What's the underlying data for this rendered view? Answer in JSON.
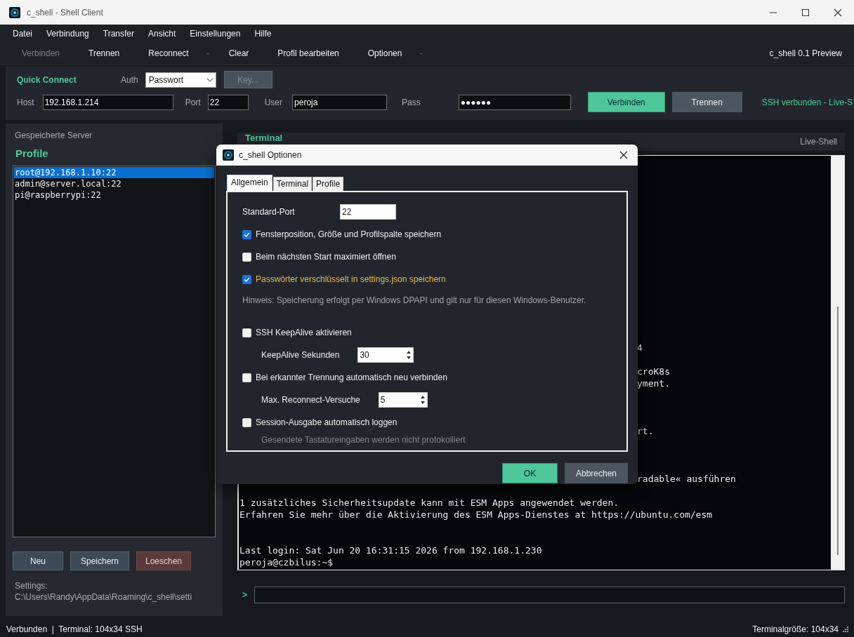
{
  "window": {
    "title": "c_shell - Shell Client"
  },
  "menu": [
    "Datei",
    "Verbindung",
    "Transfer",
    "Ansicht",
    "Einstellungen",
    "Hilfe"
  ],
  "toolbar": {
    "items": [
      {
        "kind": "button",
        "label": "Verbinden",
        "disabled": true
      },
      {
        "kind": "button",
        "label": "Trennen",
        "disabled": false
      },
      {
        "kind": "button",
        "label": "Reconnect",
        "disabled": false
      },
      {
        "kind": "separator",
        "label": "-"
      },
      {
        "kind": "button",
        "label": "Clear",
        "disabled": false
      },
      {
        "kind": "button",
        "label": "Profil bearbeiten",
        "disabled": false
      },
      {
        "kind": "button",
        "label": "Optionen",
        "disabled": false
      },
      {
        "kind": "separator",
        "label": "-"
      }
    ],
    "version": "c_shell 0.1 Preview"
  },
  "quick_connect": {
    "title": "Quick Connect",
    "auth_label": "Auth",
    "auth_value": "Passwort",
    "key_button": {
      "label": "Key...",
      "disabled": true
    },
    "host_label": "Host",
    "host": "192.168.1.214",
    "port_label": "Port",
    "port": "22",
    "user_label": "User",
    "user": "peroja",
    "pass_label": "Pass",
    "pass": "●●●●●●",
    "connect_button": "Verbinden",
    "disconnect_button": "Trennen",
    "status": "SSH verbunden - Live-S"
  },
  "profiles": {
    "caption": "Gespeicherte Server",
    "title": "Profile",
    "items": [
      {
        "label": "root@192.168.1.10:22",
        "selected": true
      },
      {
        "label": "admin@server.local:22",
        "selected": false
      },
      {
        "label": "pi@raspberrypi:22",
        "selected": false
      }
    ],
    "buttons": [
      {
        "label": "Neu",
        "kind": "normal"
      },
      {
        "label": "Speichern",
        "kind": "normal"
      },
      {
        "label": "Loeschen",
        "kind": "danger"
      }
    ],
    "settings_label": "Settings:",
    "settings_path": "C:\\Users\\Randy\\AppData\\Roaming\\c_shell\\setti"
  },
  "terminal": {
    "title": "Terminal",
    "mode": "Live-Shell",
    "prompt": ">",
    "lines": [
      {
        "kind": "tail",
        "text": "4"
      },
      {
        "kind": "blank"
      },
      {
        "kind": "tail",
        "text": "croK8s"
      },
      {
        "kind": "tail",
        "text": "yment."
      },
      {
        "kind": "blank"
      },
      {
        "kind": "blank"
      },
      {
        "kind": "blank"
      },
      {
        "kind": "tail",
        "text": "rt."
      },
      {
        "kind": "blank"
      },
      {
        "kind": "blank"
      },
      {
        "kind": "blank"
      },
      {
        "kind": "tail",
        "text": "radable« ausführen"
      },
      {
        "kind": "blank"
      },
      {
        "kind": "full",
        "text": "1 zusätzliches Sicherheitsupdate kann mit ESM Apps angewendet werden."
      },
      {
        "kind": "full",
        "text": "Erfahren Sie mehr über die Aktivierung des ESM Apps-Dienstes at https://ubuntu.com/esm"
      },
      {
        "kind": "blank"
      },
      {
        "kind": "blank"
      },
      {
        "kind": "full",
        "text": "Last login: Sat Jun 20 16:31:15 2026 from 192.168.1.230"
      },
      {
        "kind": "full",
        "text": "peroja@czbilus:~$"
      }
    ]
  },
  "dialog": {
    "title": "c_shell Optionen",
    "tabs": [
      {
        "label": "Allgemein",
        "selected": true
      },
      {
        "label": "Terminal",
        "selected": false
      },
      {
        "label": "Profile",
        "selected": false
      }
    ],
    "rows": [
      {
        "kind": "field",
        "label": "Standard-Port",
        "value": "22"
      },
      {
        "kind": "checkbox",
        "label": "Fensterposition, Größe und Profilspalte speichern",
        "checked": true,
        "warning": false
      },
      {
        "kind": "checkbox",
        "label": "Beim nächsten Start maximiert öffnen",
        "checked": false,
        "warning": false
      },
      {
        "kind": "checkbox",
        "label": "Passwörter verschlüsselt in settings.json speichern",
        "checked": true,
        "warning": true
      },
      {
        "kind": "note",
        "text": "Hinweis: Speicherung erfolgt per Windows DPAPI und gilt nur für diesen Windows-Benutzer."
      },
      {
        "kind": "checkbox",
        "label": "SSH KeepAlive aktivieren",
        "checked": false,
        "warning": false
      },
      {
        "kind": "spinner",
        "label": "KeepAlive Sekunden",
        "value": "30"
      },
      {
        "kind": "checkbox",
        "label": "Bei erkannter Trennung automatisch neu verbinden",
        "checked": false,
        "warning": false
      },
      {
        "kind": "spinner",
        "label": "Max. Reconnect-Versuche",
        "value": "5"
      },
      {
        "kind": "checkbox",
        "label": "Session-Ausgabe automatisch loggen",
        "checked": false,
        "warning": false
      },
      {
        "kind": "subnote",
        "text": "Gesendete Tastatureingaben werden nicht protokolliert"
      }
    ],
    "buttons": [
      {
        "label": "OK",
        "kind": "primary"
      },
      {
        "label": "Abbrechen",
        "kind": "secondary"
      }
    ]
  },
  "status_bar": {
    "left": "Verbunden  |  Terminal: 104x34 SSH",
    "right": "Terminalgröße: 104x34"
  }
}
